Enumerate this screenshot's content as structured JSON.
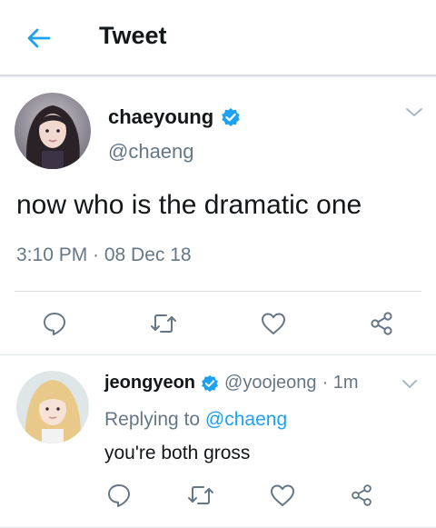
{
  "colors": {
    "accent": "#1da1f2",
    "text_primary": "#14171a",
    "text_secondary": "#657786",
    "divider": "#e1e8ed"
  },
  "header": {
    "title": "Tweet",
    "back_icon": "back-arrow-icon"
  },
  "main_tweet": {
    "name": "chaeyoung",
    "handle": "@chaeng",
    "text": "now who is the dramatic one",
    "timestamp": "3:10 PM · 08 Dec 18",
    "verified_icon": "verified-badge-icon",
    "caret_icon": "chevron-down-icon",
    "actions": [
      "reply-icon",
      "retweet-icon",
      "like-icon",
      "share-icon"
    ]
  },
  "reply": {
    "name": "jeongyeon",
    "handle": "@yoojeong",
    "time": "· 1m",
    "replying_prefix": "Replying to",
    "replying_mention": "@chaeng",
    "text": "you're both gross",
    "verified_icon": "verified-badge-icon",
    "caret_icon": "chevron-down-icon",
    "actions": [
      "reply-icon",
      "retweet-icon",
      "like-icon",
      "share-icon"
    ]
  }
}
